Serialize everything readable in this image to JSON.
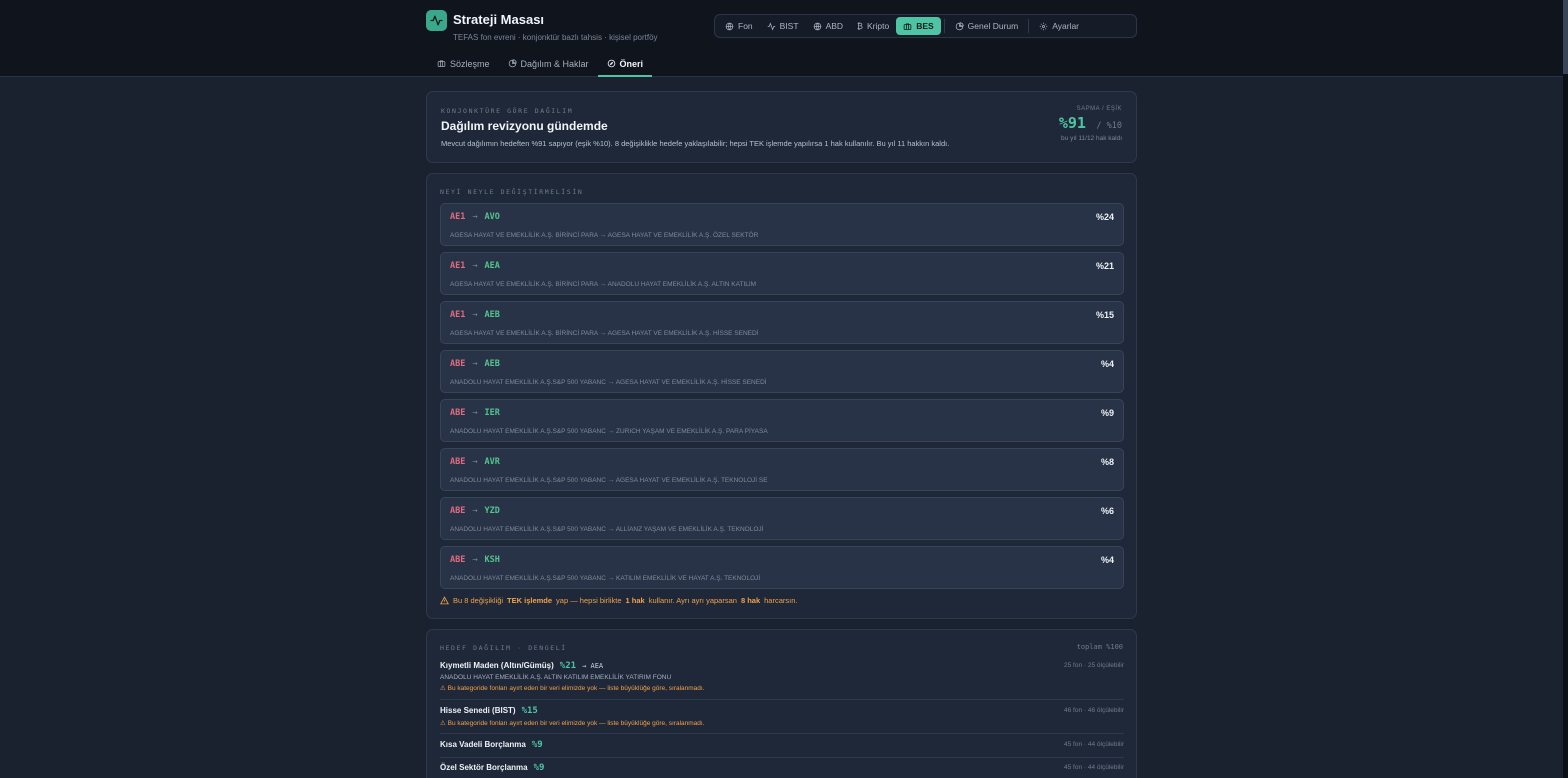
{
  "app": {
    "title": "Strateji Masası",
    "subtitle": "TEFAS fon evreni · konjonktür bazlı tahsis · kişisel portföy"
  },
  "topnav": [
    {
      "label": "Fon",
      "icon": "globe-icon"
    },
    {
      "label": "BIST",
      "icon": "activity-icon"
    },
    {
      "label": "ABD",
      "icon": "globe-icon"
    },
    {
      "label": "Kripto",
      "icon": "bitcoin-icon"
    },
    {
      "label": "BES",
      "icon": "briefcase-icon",
      "active": true
    },
    {
      "label": "Genel Durum",
      "icon": "pie-chart-icon"
    },
    {
      "label": "Ayarlar",
      "icon": "gear-icon"
    }
  ],
  "subtabs": [
    {
      "label": "Sözleşme",
      "icon": "briefcase-icon"
    },
    {
      "label": "Dağılım & Haklar",
      "icon": "pie-chart-icon"
    },
    {
      "label": "Öneri",
      "icon": "compass-icon",
      "active": true
    }
  ],
  "summary": {
    "eyebrow": "KONJONKTÜRE GÖRE DAĞILIM",
    "title": "Dağılım revizyonu gündemde",
    "description": "Mevcut dağılımın hedeften %91 sapıyor (eşik %10). 8 değişiklikle hedefe yaklaşılabilir; hepsi TEK işlemde yapılırsa 1 hak kullanılır. Bu yıl 11 hakkın kaldı.",
    "deviation_label": "SAPMA / EŞİK",
    "deviation_value": "%91",
    "threshold": "/ %10",
    "rights_text": "bu yıl 11/12 hak kaldı"
  },
  "swaps": {
    "eyebrow": "NEYİ NEYLE DEĞİŞTİRMELİSİN",
    "arrow": "→",
    "items": [
      {
        "from": "AE1",
        "to": "AVO",
        "pct": "%24",
        "desc": "AGESA HAYAT VE EMEKLİLİK A.Ş. BİRİNCİ PARA → AGESA HAYAT VE EMEKLİLİK A.Ş. ÖZEL SEKTÖR"
      },
      {
        "from": "AE1",
        "to": "AEA",
        "pct": "%21",
        "desc": "AGESA HAYAT VE EMEKLİLİK A.Ş. BİRİNCİ PARA → ANADOLU HAYAT EMEKLİLİK A.Ş. ALTIN KATILIM"
      },
      {
        "from": "AE1",
        "to": "AEB",
        "pct": "%15",
        "desc": "AGESA HAYAT VE EMEKLİLİK A.Ş. BİRİNCİ PARA → AGESA HAYAT VE EMEKLİLİK A.Ş. HİSSE SENEDİ"
      },
      {
        "from": "ABE",
        "to": "AEB",
        "pct": "%4",
        "desc": "ANADOLU HAYAT EMEKLİLİK A.Ş.S&P 500 YABANC → AGESA HAYAT VE EMEKLİLİK A.Ş. HİSSE SENEDİ"
      },
      {
        "from": "ABE",
        "to": "IER",
        "pct": "%9",
        "desc": "ANADOLU HAYAT EMEKLİLİK A.Ş.S&P 500 YABANC → ZURICH YAŞAM VE EMEKLİLİK A.Ş. PARA PİYASA"
      },
      {
        "from": "ABE",
        "to": "AVR",
        "pct": "%8",
        "desc": "ANADOLU HAYAT EMEKLİLİK A.Ş.S&P 500 YABANC → AGESA HAYAT VE EMEKLİLİK A.Ş. TEKNOLOJİ SE"
      },
      {
        "from": "ABE",
        "to": "YZD",
        "pct": "%6",
        "desc": "ANADOLU HAYAT EMEKLİLİK A.Ş.S&P 500 YABANC → ALLİANZ YAŞAM VE EMEKLİLİK A.Ş. TEKNOLOJİ"
      },
      {
        "from": "ABE",
        "to": "KSH",
        "pct": "%4",
        "desc": "ANADOLU HAYAT EMEKLİLİK A.Ş.S&P 500 YABANC → KATILIM EMEKLİLİK VE HAYAT A.Ş. TEKNOLOJİ"
      }
    ],
    "warning_pre": "Bu 8 değişikliği",
    "warning_b1": "TEK işlemde",
    "warning_mid1": "yap — hepsi birlikte",
    "warning_b2": "1 hak",
    "warning_mid2": "kullanır. Ayrı ayrı yaparsan",
    "warning_b3": "8 hak",
    "warning_post": "harcarsın."
  },
  "target": {
    "eyebrow": "HEDEF DAĞILIM · DENGELİ",
    "total": "toplam %100",
    "rows": [
      {
        "name": "Kıymetli Maden (Altın/Gümüş)",
        "pct": "%21",
        "arrow_code": "→ AEA",
        "count": "25 fon · 25 ölçülebilir",
        "fund": "ANADOLU HAYAT EMEKLİLİK A.Ş. ALTIN KATILIM EMEKLİLİK YATIRIM FONU",
        "warn": "⚠ Bu kategoride fonları ayırt eden bir veri elimizde yok — liste büyüklüğe göre, sıralanmadı."
      },
      {
        "name": "Hisse Senedi (BIST)",
        "pct": "%15",
        "count": "46 fon · 46 ölçülebilir",
        "warn": "⚠ Bu kategoride fonları ayırt eden bir veri elimizde yok — liste büyüklüğe göre, sıralanmadı."
      },
      {
        "name": "Kısa Vadeli Borçlanma",
        "pct": "%9",
        "count": "45 fon · 44 ölçülebilir"
      },
      {
        "name": "Özel Sektör Borçlanma",
        "pct": "%9",
        "count": "45 fon · 44 ölçülebilir"
      }
    ]
  },
  "colors": {
    "accent": "#4fc4a5",
    "from_code": "#e06b7f",
    "to_code": "#52c48d",
    "warning": "#f0a14a"
  }
}
